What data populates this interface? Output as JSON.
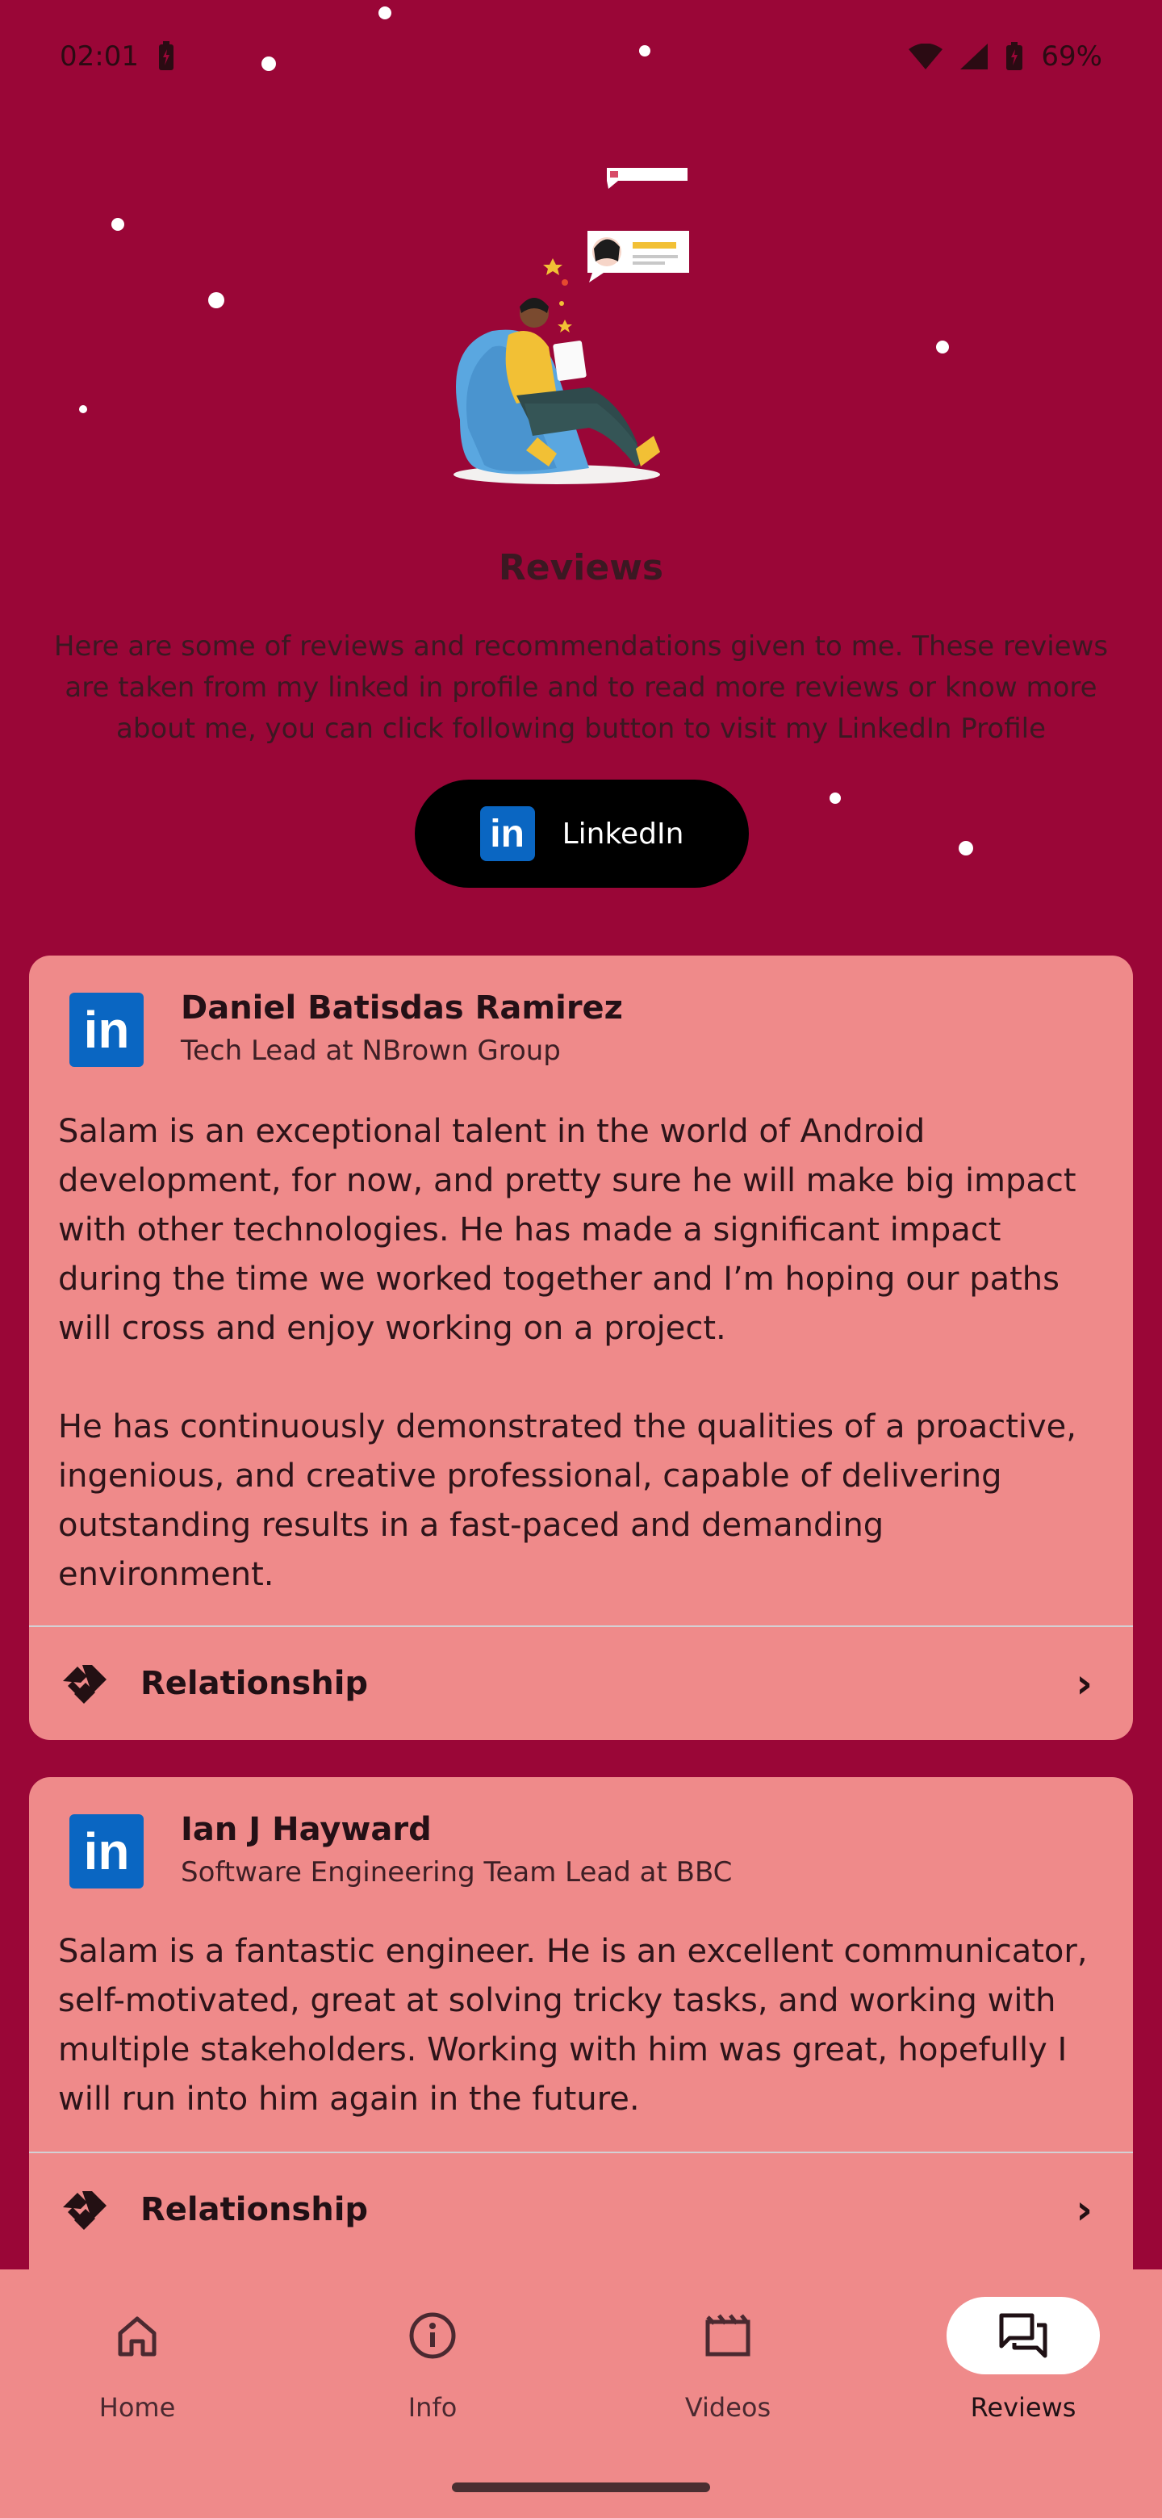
{
  "status_bar": {
    "time": "02:01",
    "battery": "69%",
    "icons": [
      "charging-icon",
      "wifi-icon",
      "signal-icon",
      "battery-icon"
    ]
  },
  "page": {
    "title": "Reviews",
    "intro": "Here are some of reviews and recommendations given to me. These reviews are taken from my linked in profile and to read more reviews or know more about me, you can click following button to visit my LinkedIn Profile",
    "linkedin_button": "LinkedIn"
  },
  "reviews": [
    {
      "name": "Daniel Batisdas Ramirez",
      "title": "Tech Lead at NBrown Group",
      "text": "Salam is an exceptional talent in the world of Android development, for now, and pretty sure he will make big impact with other technologies. He has made a significant impact during the time we worked together and I’m hoping our paths will cross and enjoy working on a project.\n\n He has continuously demonstrated the qualities of a proactive, ingenious, and creative professional, capable of delivering outstanding results in a fast-paced and demanding environment.",
      "relationship_label": "Relationship"
    },
    {
      "name": "Ian J Hayward",
      "title": "Software Engineering Team Lead at BBC",
      "text": "Salam is a fantastic engineer. He is an excellent communicator, self-motivated, great at solving tricky tasks, and working with multiple stakeholders. Working with him was great, hopefully I will run into him again in the future.",
      "relationship_label": "Relationship"
    }
  ],
  "nav": {
    "items": [
      {
        "label": "Home",
        "icon": "home-icon"
      },
      {
        "label": "Info",
        "icon": "info-icon"
      },
      {
        "label": "Videos",
        "icon": "video-icon"
      },
      {
        "label": "Reviews",
        "icon": "reviews-icon",
        "active": true
      }
    ]
  },
  "colors": {
    "background": "#9A0637",
    "card": "#EF8A8A",
    "linkedin_blue": "#0A66C2",
    "button": "#000000"
  }
}
